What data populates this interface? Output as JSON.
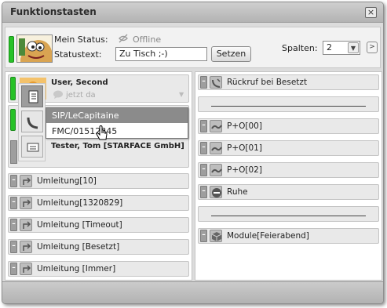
{
  "window": {
    "title": "Funktionstasten",
    "close_label": "×"
  },
  "status": {
    "mein_status_label": "Mein Status:",
    "mein_status_value": "Offline",
    "statustext_label": "Statustext:",
    "statustext_value": "Zu Tisch ;-)",
    "setzen_label": "Setzen",
    "spalten_label": "Spalten:",
    "spalten_value": "2",
    "next_label": ">"
  },
  "left_column": {
    "user1": {
      "name": "User, Second",
      "presence": "jetzt da"
    },
    "user2": {
      "name": "Tester, Tom [STARFACE GmbH]"
    },
    "dropdown": {
      "items": [
        "SIP/LeCapitaine",
        "FMC/01512345"
      ]
    },
    "keys": [
      {
        "label": "Umleitung[10]",
        "icon": "forward-icon"
      },
      {
        "label": "Umleitung[1320829]",
        "icon": "forward-icon"
      },
      {
        "label": "Umleitung [Timeout]",
        "icon": "forward-icon"
      },
      {
        "label": "Umleitung [Besetzt]",
        "icon": "forward-icon"
      },
      {
        "label": "Umleitung [Immer]",
        "icon": "forward-icon"
      }
    ]
  },
  "right_column": {
    "keys": [
      {
        "label": "Rückruf bei Besetzt",
        "icon": "callback-icon"
      },
      {
        "label": "",
        "icon": "separator"
      },
      {
        "label": "P+O[00]",
        "icon": "pickup-icon"
      },
      {
        "label": "P+O[01]",
        "icon": "pickup-icon"
      },
      {
        "label": "P+O[02]",
        "icon": "pickup-icon"
      },
      {
        "label": "Ruhe",
        "icon": "do-not-disturb-icon"
      },
      {
        "label": "",
        "icon": "separator"
      },
      {
        "label": "Module[Feierabend]",
        "icon": "module-icon"
      }
    ]
  },
  "colors": {
    "led_green": "#27c227",
    "dropdown_selected": "#8b8b8b"
  }
}
